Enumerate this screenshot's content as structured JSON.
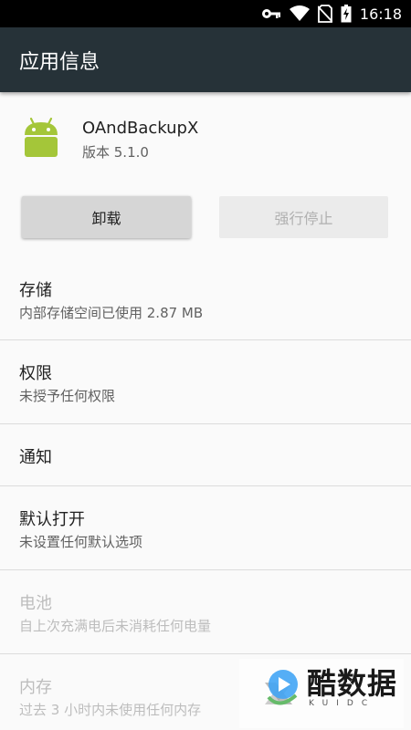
{
  "status_bar": {
    "time": "16:18",
    "icons": [
      "vpn-key-icon",
      "wifi-icon",
      "no-sim-icon",
      "battery-charging-icon"
    ]
  },
  "app_bar": {
    "title": "应用信息"
  },
  "app": {
    "name": "OAndBackupX",
    "version": "版本 5.1.0",
    "icon": "android-icon"
  },
  "buttons": {
    "uninstall": "卸载",
    "force_stop": "强行停止"
  },
  "settings": [
    {
      "title": "存储",
      "summary": "内部存储空间已使用 2.87 MB",
      "enabled": true
    },
    {
      "title": "权限",
      "summary": "未授予任何权限",
      "enabled": true
    },
    {
      "title": "通知",
      "summary": "",
      "enabled": true
    },
    {
      "title": "默认打开",
      "summary": "未设置任何默认选项",
      "enabled": true
    },
    {
      "title": "电池",
      "summary": "自上次充满电后未消耗任何电量",
      "enabled": false
    },
    {
      "title": "内存",
      "summary": "过去 3 小时内未使用任何内存",
      "enabled": false
    }
  ],
  "watermark": {
    "name": "酷数据",
    "sub": "KUIDC"
  },
  "colors": {
    "app_bar": "#263238",
    "status_bar": "#000000",
    "android_green": "#a4c639",
    "background": "#fafafa"
  }
}
